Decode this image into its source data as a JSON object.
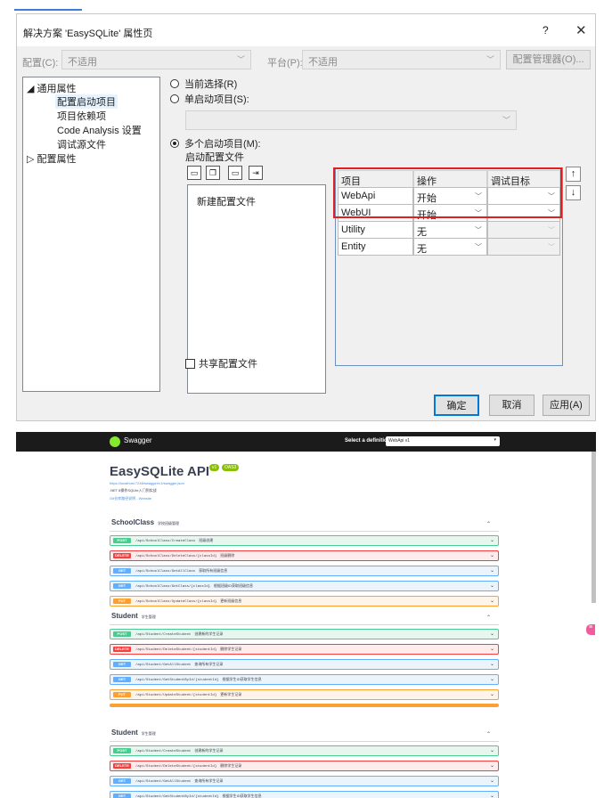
{
  "dialog": {
    "title": "解决方案 'EasySQLite' 属性页",
    "help": "?",
    "close": "✕",
    "config_label": "配置(C):",
    "config_value": "不适用",
    "platform_label": "平台(P):",
    "platform_value": "不适用",
    "config_manager": "配置管理器(O)...",
    "tree": [
      {
        "label": "通用属性",
        "expanded": true
      },
      {
        "label": "配置启动项目",
        "selected": true
      },
      {
        "label": "项目依赖项"
      },
      {
        "label": "Code Analysis 设置"
      },
      {
        "label": "调试源文件"
      },
      {
        "label": "配置属性",
        "expanded": false
      }
    ],
    "radio_current": "当前选择(R)",
    "radio_single": "单启动项目(S):",
    "radio_multi": "多个启动项目(M):",
    "profile_label": "启动配置文件",
    "profile_item": "新建配置文件",
    "grid_headers": [
      "项目",
      "操作",
      "调试目标"
    ],
    "grid_rows": [
      {
        "project": "WebApi",
        "action": "开始",
        "target": ""
      },
      {
        "project": "WebUI",
        "action": "开始",
        "target": ""
      },
      {
        "project": "Utility",
        "action": "无",
        "target": ""
      },
      {
        "project": "Entity",
        "action": "无",
        "target": ""
      }
    ],
    "up": "↑",
    "down": "↓",
    "share_label": "共享配置文件",
    "ok": "确定",
    "cancel": "取消",
    "apply": "应用(A)"
  },
  "swagger": {
    "brand": "Swagger",
    "select_label": "Select a definition",
    "select_value": "WebApi v1",
    "api_title": "EasySQLite API",
    "badge_version": "v1",
    "badge_oas": "OAS3",
    "url": "https://localhost:7248/swagger/v1/swagger.json",
    "desc": ".NET 8操作SQLite入门到实战",
    "website": "Git仓库路径说明 - Website",
    "sections": [
      {
        "name": "SchoolClass",
        "desc": "学校班级管理",
        "ops": [
          {
            "method": "POST",
            "path": "/api/SchoolClass/CreateClass",
            "summary": "班级创建"
          },
          {
            "method": "DELETE",
            "path": "/api/SchoolClass/DeleteClass/{classId}",
            "summary": "班级删除"
          },
          {
            "method": "GET",
            "path": "/api/SchoolClass/GetAllClass",
            "summary": "获取所有班级信息"
          },
          {
            "method": "GET",
            "path": "/api/SchoolClass/GetClass/{classId}",
            "summary": "根据班级ID获取班级信息"
          },
          {
            "method": "PUT",
            "path": "/api/SchoolClass/UpdateClass/{classId}",
            "summary": "更新班级信息"
          }
        ]
      },
      {
        "name": "Student",
        "desc": "学生管理",
        "ops": [
          {
            "method": "POST",
            "path": "/api/Student/CreateStudent",
            "summary": "创建新的学生记录"
          },
          {
            "method": "DELETE",
            "path": "/api/Student/DeleteStudent/{studentId}",
            "summary": "删除学生记录"
          },
          {
            "method": "GET",
            "path": "/api/Student/GetAllStudent",
            "summary": "查询所有学生记录"
          },
          {
            "method": "GET",
            "path": "/api/Student/GetStudentById/{studentId}",
            "summary": "根据学生ID获取学生信息"
          },
          {
            "method": "PUT",
            "path": "/api/Student/UpdateStudent/{studentId}",
            "summary": "更新学生记录"
          }
        ]
      }
    ],
    "colors": {
      "POST": "#49cc90",
      "DELETE": "#f93e3e",
      "GET": "#61affe",
      "PUT": "#fca130"
    },
    "bg": {
      "POST": "#e8f6f0",
      "DELETE": "#feebeb",
      "GET": "#ebf3fb",
      "PUT": "#fef4e9"
    }
  }
}
